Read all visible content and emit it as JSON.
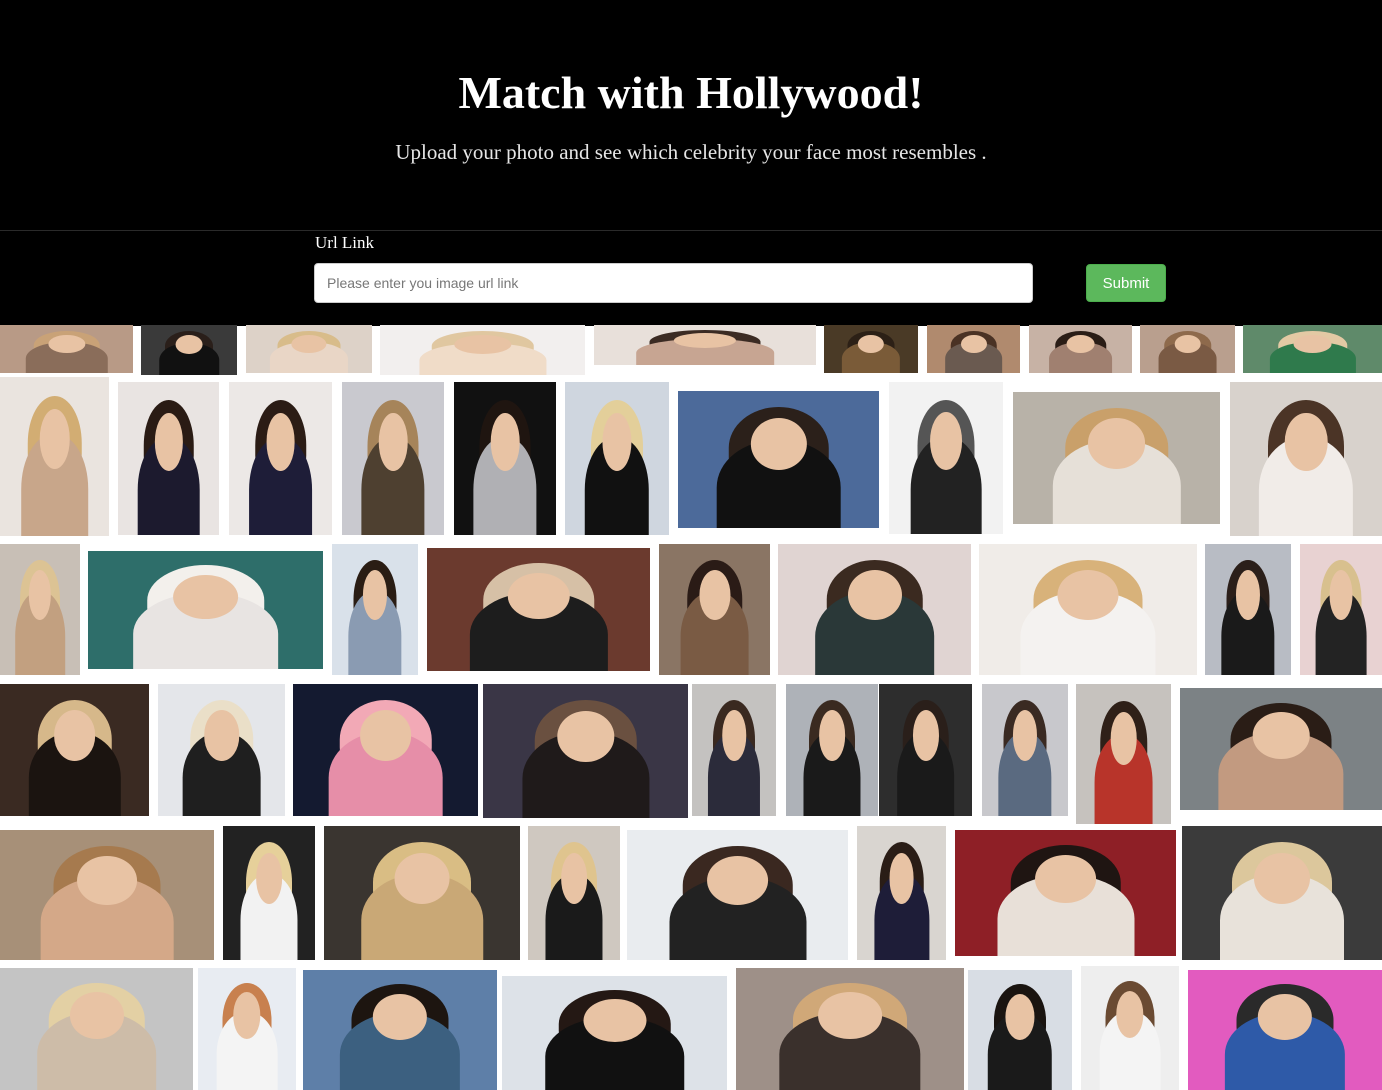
{
  "header": {
    "title": "Match with Hollywood!",
    "subtitle": "Upload your photo and see which celebrity your face most resembles ."
  },
  "form": {
    "label": "Url Link",
    "placeholder": "Please enter you image url link",
    "value": "",
    "submit_label": "Submit"
  },
  "gallery": {
    "description_icon": "celebrity-photo-thumbnail"
  },
  "colors": {
    "hero_bg": "#000000",
    "submit_bg": "#5cb85c",
    "page_bg": "#ffffff"
  }
}
